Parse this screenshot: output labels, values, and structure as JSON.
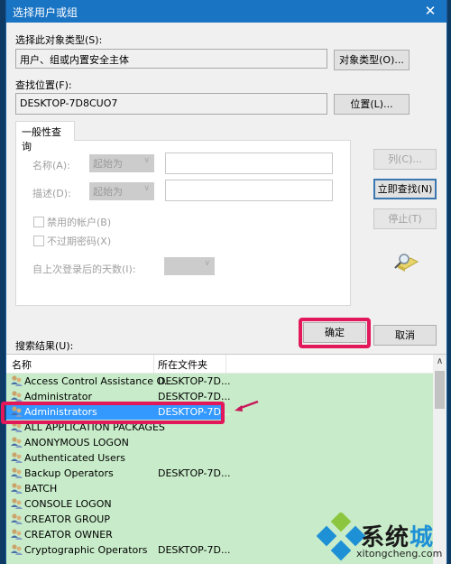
{
  "window": {
    "title": "选择用户或组",
    "close_icon": "close-icon"
  },
  "object_type": {
    "label": "选择此对象类型(S):",
    "value": "用户、组或内置安全主体",
    "button": "对象类型(O)..."
  },
  "location": {
    "label": "查找位置(F):",
    "value": "DESKTOP-7D8CUO7",
    "button": "位置(L)..."
  },
  "query": {
    "tab_label": "一般性查询",
    "name_label": "名称(A):",
    "name_mode": "起始为",
    "name_value": "",
    "desc_label": "描述(D):",
    "desc_mode": "起始为",
    "desc_value": "",
    "disabled_accounts_label": "禁用的帐户(B)",
    "disabled_accounts_checked": false,
    "no_expire_label": "不过期密码(X)",
    "no_expire_checked": false,
    "days_label": "自上次登录后的天数(I):",
    "days_value": ""
  },
  "side_buttons": {
    "columns": "列(C)...",
    "find_now": "立即查找(N)",
    "stop": "停止(T)",
    "search_icon": "search-folder-icon"
  },
  "dialog_buttons": {
    "ok": "确定",
    "cancel": "取消"
  },
  "results": {
    "label": "搜索结果(U):",
    "columns": [
      "名称",
      "所在文件夹"
    ],
    "rows": [
      {
        "name": "Access Control Assistance O...",
        "folder": "DESKTOP-7D...",
        "selected": false
      },
      {
        "name": "Administrator",
        "folder": "DESKTOP-7D...",
        "selected": false
      },
      {
        "name": "Administrators",
        "folder": "DESKTOP-7D...",
        "selected": true
      },
      {
        "name": "ALL APPLICATION PACKAGES",
        "folder": "",
        "selected": false
      },
      {
        "name": "ANONYMOUS LOGON",
        "folder": "",
        "selected": false
      },
      {
        "name": "Authenticated Users",
        "folder": "",
        "selected": false
      },
      {
        "name": "Backup Operators",
        "folder": "DESKTOP-7D...",
        "selected": false
      },
      {
        "name": "BATCH",
        "folder": "",
        "selected": false
      },
      {
        "name": "CONSOLE LOGON",
        "folder": "",
        "selected": false
      },
      {
        "name": "CREATOR GROUP",
        "folder": "",
        "selected": false
      },
      {
        "name": "CREATOR OWNER",
        "folder": "",
        "selected": false
      },
      {
        "name": "Cryptographic Operators",
        "folder": "DESKTOP-7D...",
        "selected": false
      }
    ]
  },
  "watermark": {
    "text_dark": "系统",
    "text_blue": "城",
    "url": "xitongcheng.com"
  },
  "colors": {
    "titlebar": "#1a74c4",
    "highlight": "#e2185b",
    "selection": "#3399ff",
    "results_bg": "#c8ecc9"
  }
}
